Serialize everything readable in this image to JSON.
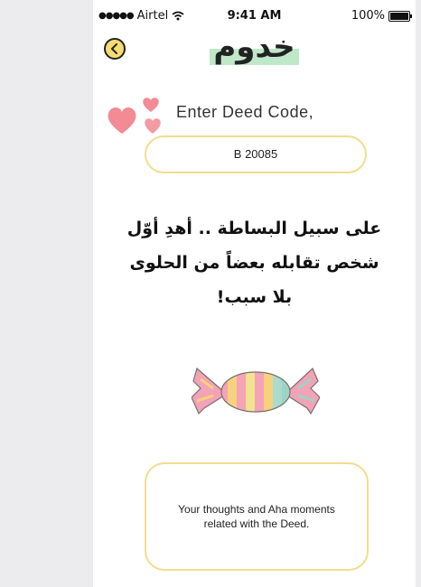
{
  "status_bar": {
    "signal": "●●●●●",
    "carrier": "Airtel",
    "wifi_icon": "wifi-icon",
    "time": "9:41 AM",
    "battery": "100%"
  },
  "header": {
    "back_icon": "chevron-left-icon",
    "logo_text": "خدوم"
  },
  "deed": {
    "label": "Enter Deed Code,",
    "code_value": "B 20085",
    "description_lines": [
      "على سبيل البساطة .. أهدِ أوّل",
      "شخص تقابله بعضاً من الحلوى",
      "بلا سبب!"
    ],
    "illustration": "candy-icon"
  },
  "thoughts": {
    "placeholder": "Your thoughts and Aha moments related with the Deed."
  },
  "colors": {
    "accent_yellow": "#f3dc8c",
    "heart_pink": "#f28b94",
    "logo_highlight": "#bfe8c8"
  }
}
